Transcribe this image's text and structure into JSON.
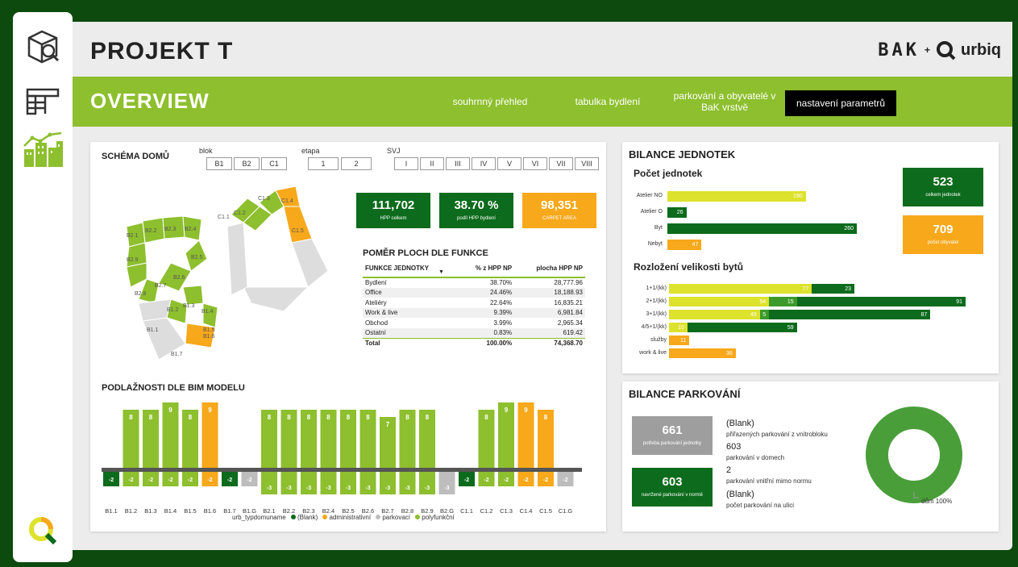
{
  "app": {
    "title": "PROJEKT T",
    "logo_text": "BAK",
    "logo_sep": "+",
    "logo_text2": "urbiq"
  },
  "nav": {
    "overview": "OVERVIEW",
    "items": [
      "souhrnný přehled",
      "tabulka bydlení",
      "parkování a obyvatelé v BaK vrstvě",
      "nastavení parametrů"
    ]
  },
  "colors": {
    "dark_green": "#0c6b1c",
    "light_green": "#8dbf2e",
    "yellow_green": "#dde22c",
    "orange": "#f7a81b",
    "grey": "#bdbdbd"
  },
  "schema": {
    "title": "SCHÉMA DOMŮ",
    "blok_label": "blok",
    "blok": [
      "B1",
      "B2",
      "C1"
    ],
    "etapa_label": "etapa",
    "etapa": [
      "1",
      "2"
    ],
    "svj_label": "SVJ",
    "svj": [
      "I",
      "II",
      "III",
      "IV",
      "V",
      "VI",
      "VII",
      "VIII"
    ],
    "map_labels": [
      "C1.1",
      "C1.2",
      "C1.3",
      "C1.4",
      "C1.5",
      "B2.1",
      "B2.2",
      "B2.3",
      "B2.4",
      "B2.5",
      "B2.6",
      "B2.7",
      "B2.8",
      "B2.9",
      "B1.1",
      "B1.2",
      "B1.3",
      "B1.4",
      "B1.5",
      "B1.6",
      "B1.7"
    ]
  },
  "kpis": [
    {
      "value": "111,702",
      "label": "HPP celkem",
      "color": "#0c6b1c"
    },
    {
      "value": "38.70 %",
      "label": "podíl HPP bydlení",
      "color": "#0c6b1c"
    },
    {
      "value": "98,351",
      "label": "CARPET AREA",
      "color": "#f7a81b"
    }
  ],
  "ratio_table": {
    "title": "POMĚR PLOCH DLE FUNKCE",
    "headers": [
      "FUNKCE JEDNOTKY",
      "% z HPP NP",
      "plocha HPP NP"
    ],
    "rows": [
      [
        "Bydlení",
        "38.70%",
        "28,777.96"
      ],
      [
        "Office",
        "24.46%",
        "18,188.93"
      ],
      [
        "Ateliéry",
        "22.64%",
        "16,835.21"
      ],
      [
        "Work & live",
        "9.39%",
        "6,981.84"
      ],
      [
        "Obchod",
        "3.99%",
        "2,965.34"
      ],
      [
        "Ostatní",
        "0.83%",
        "619.42"
      ]
    ],
    "total": [
      "Total",
      "100.00%",
      "74,368.70"
    ]
  },
  "floors_chart": {
    "title": "PODLAŽNOSTI DLE BIM MODELU",
    "legend_title": "urb_typdomuname",
    "legend": [
      {
        "name": "(Blank)",
        "color": "#0c6b1c"
      },
      {
        "name": "administrativní",
        "color": "#f7a81b"
      },
      {
        "name": "parkovací",
        "color": "#bdbdbd"
      },
      {
        "name": "polyfunkční",
        "color": "#8dbf2e"
      }
    ]
  },
  "chart_data": {
    "type": "bar",
    "title": "PODLAŽNOSTI DLE BIM MODELU",
    "categories": [
      "B1.1",
      "B1.2",
      "B1.3",
      "B1.4",
      "B1.5",
      "B1.6",
      "B1.7",
      "B1.G",
      "B2.1",
      "B2.2",
      "B2.3",
      "B2.4",
      "B2.5",
      "B2.6",
      "B2.7",
      "B2.8",
      "B2.9",
      "B2.G",
      "C1.1",
      "C1.2",
      "C1.3",
      "C1.4",
      "C1.5",
      "C1.G"
    ],
    "above": [
      null,
      8,
      8,
      9,
      8,
      9,
      null,
      null,
      8,
      8,
      8,
      8,
      8,
      8,
      7,
      8,
      8,
      null,
      null,
      8,
      9,
      9,
      8,
      null
    ],
    "below": [
      -2,
      -2,
      -2,
      -2,
      -2,
      -2,
      -2,
      -2,
      -3,
      -3,
      -3,
      -3,
      -3,
      -3,
      -3,
      -3,
      -3,
      -3,
      -2,
      -2,
      -2,
      -2,
      -2,
      -2
    ],
    "types": [
      "blank",
      "poly",
      "poly",
      "poly",
      "poly",
      "admin",
      "blank",
      "park",
      "poly",
      "poly",
      "poly",
      "poly",
      "poly",
      "poly",
      "poly",
      "poly",
      "poly",
      "park",
      "blank",
      "poly",
      "poly",
      "admin",
      "admin",
      "park"
    ],
    "type_colors": {
      "blank": "#0c6b1c",
      "poly": "#8dbf2e",
      "admin": "#f7a81b",
      "park": "#bdbdbd"
    },
    "series": [
      {
        "name": "(Blank)"
      },
      {
        "name": "administrativní"
      },
      {
        "name": "parkovací"
      },
      {
        "name": "polyfunkční"
      }
    ]
  },
  "units": {
    "title": "BILANCE JEDNOTEK",
    "count_title": "Počet jednotek",
    "count": [
      {
        "label": "Atelier NO",
        "value": 190,
        "color": "#dde22c"
      },
      {
        "label": "Atelier O",
        "value": 26,
        "color": "#0c6b1c"
      },
      {
        "label": "Byt",
        "value": 260,
        "color": "#0c6b1c"
      },
      {
        "label": "Nebyt",
        "value": 47,
        "color": "#f7a81b"
      }
    ],
    "size_title": "Rozložení velikosti bytů",
    "sizes": [
      {
        "label": "1+1/(kk)",
        "parts": [
          {
            "v": 77,
            "c": "#dde22c"
          },
          {
            "v": 23,
            "c": "#0c6b1c"
          }
        ]
      },
      {
        "label": "2+1/(kk)",
        "parts": [
          {
            "v": 54,
            "c": "#dde22c"
          },
          {
            "v": 15,
            "c": "#3b9a2a"
          },
          {
            "v": 91,
            "c": "#0c6b1c"
          }
        ]
      },
      {
        "label": "3+1/(kk)",
        "parts": [
          {
            "v": 49,
            "c": "#dde22c"
          },
          {
            "v": 5,
            "c": "#3b9a2a"
          },
          {
            "v": 87,
            "c": "#0c6b1c"
          }
        ]
      },
      {
        "label": "4/5+1/(kk)",
        "parts": [
          {
            "v": 10,
            "c": "#dde22c"
          },
          {
            "v": 59,
            "c": "#0c6b1c"
          }
        ]
      },
      {
        "label": "služby",
        "parts": [
          {
            "v": 11,
            "c": "#f7a81b"
          }
        ]
      },
      {
        "label": "work & live",
        "parts": [
          {
            "v": 36,
            "c": "#f7a81b"
          }
        ]
      }
    ],
    "total": {
      "value": "523",
      "label": "celkem jednotek"
    },
    "residents": {
      "value": "709",
      "label": "počet obyvatel"
    }
  },
  "parking": {
    "title": "BILANCE PARKOVÁNÍ",
    "need": {
      "value": "661",
      "label": "potřeba parkování jednotky"
    },
    "proposed": {
      "value": "603",
      "label": "navržené parkování v normě"
    },
    "items": [
      {
        "value": "(Blank)",
        "label": "přiřazených parkování z vnitrobloku"
      },
      {
        "value": "603",
        "label": "parkování v domech"
      },
      {
        "value": "2",
        "label": "parkování vnitřní mimo normu"
      },
      {
        "value": "(Blank)",
        "label": "počet parkování na ulici"
      }
    ],
    "donut_label": "dům 100%"
  }
}
